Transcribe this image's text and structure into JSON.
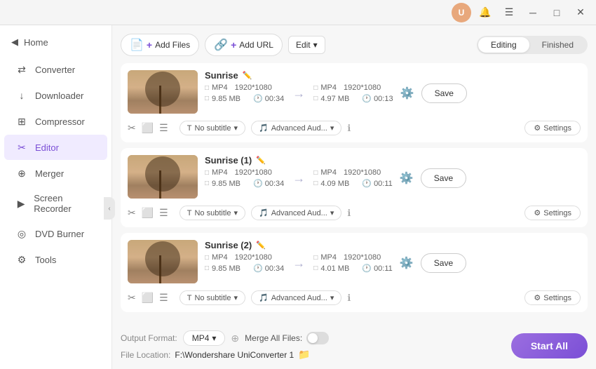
{
  "titlebar": {
    "user_initial": "U",
    "user_color": "#e8a87c"
  },
  "sidebar": {
    "home_label": "Home",
    "items": [
      {
        "id": "converter",
        "label": "Converter",
        "icon": "⇄",
        "active": false
      },
      {
        "id": "downloader",
        "label": "Downloader",
        "icon": "↓",
        "active": false
      },
      {
        "id": "compressor",
        "label": "Compressor",
        "icon": "⊞",
        "active": false
      },
      {
        "id": "editor",
        "label": "Editor",
        "icon": "✂",
        "active": true
      },
      {
        "id": "merger",
        "label": "Merger",
        "icon": "⊕",
        "active": false
      },
      {
        "id": "screen-recorder",
        "label": "Screen Recorder",
        "icon": "▶",
        "active": false
      },
      {
        "id": "dvd-burner",
        "label": "DVD Burner",
        "icon": "◎",
        "active": false
      },
      {
        "id": "tools",
        "label": "Tools",
        "icon": "⚙",
        "active": false
      }
    ]
  },
  "toolbar": {
    "add_file_label": "Add Files",
    "add_url_label": "Add URL",
    "edit_label": "Edit",
    "tab_editing": "Editing",
    "tab_finished": "Finished"
  },
  "files": [
    {
      "name": "Sunrise",
      "src_format": "MP4",
      "src_resolution": "1920*1080",
      "src_size": "9.85 MB",
      "src_duration": "00:34",
      "dst_format": "MP4",
      "dst_resolution": "1920*1080",
      "dst_size": "4.97 MB",
      "dst_duration": "00:13",
      "subtitle": "No subtitle",
      "audio": "Advanced Aud...",
      "settings_label": "Settings",
      "save_label": "Save"
    },
    {
      "name": "Sunrise (1)",
      "src_format": "MP4",
      "src_resolution": "1920*1080",
      "src_size": "9.85 MB",
      "src_duration": "00:34",
      "dst_format": "MP4",
      "dst_resolution": "1920*1080",
      "dst_size": "4.09 MB",
      "dst_duration": "00:11",
      "subtitle": "No subtitle",
      "audio": "Advanced Aud...",
      "settings_label": "Settings",
      "save_label": "Save"
    },
    {
      "name": "Sunrise (2)",
      "src_format": "MP4",
      "src_resolution": "1920*1080",
      "src_size": "9.85 MB",
      "src_duration": "00:34",
      "dst_format": "MP4",
      "dst_resolution": "1920*1080",
      "dst_size": "4.01 MB",
      "dst_duration": "00:11",
      "subtitle": "No subtitle",
      "audio": "Advanced Aud...",
      "settings_label": "Settings",
      "save_label": "Save"
    }
  ],
  "footer": {
    "output_format_label": "Output Format:",
    "output_format_value": "MP4",
    "file_location_label": "File Location:",
    "file_location_value": "F:\\Wondershare UniConverter 1",
    "merge_all_label": "Merge All Files:",
    "start_all_label": "Start All"
  }
}
